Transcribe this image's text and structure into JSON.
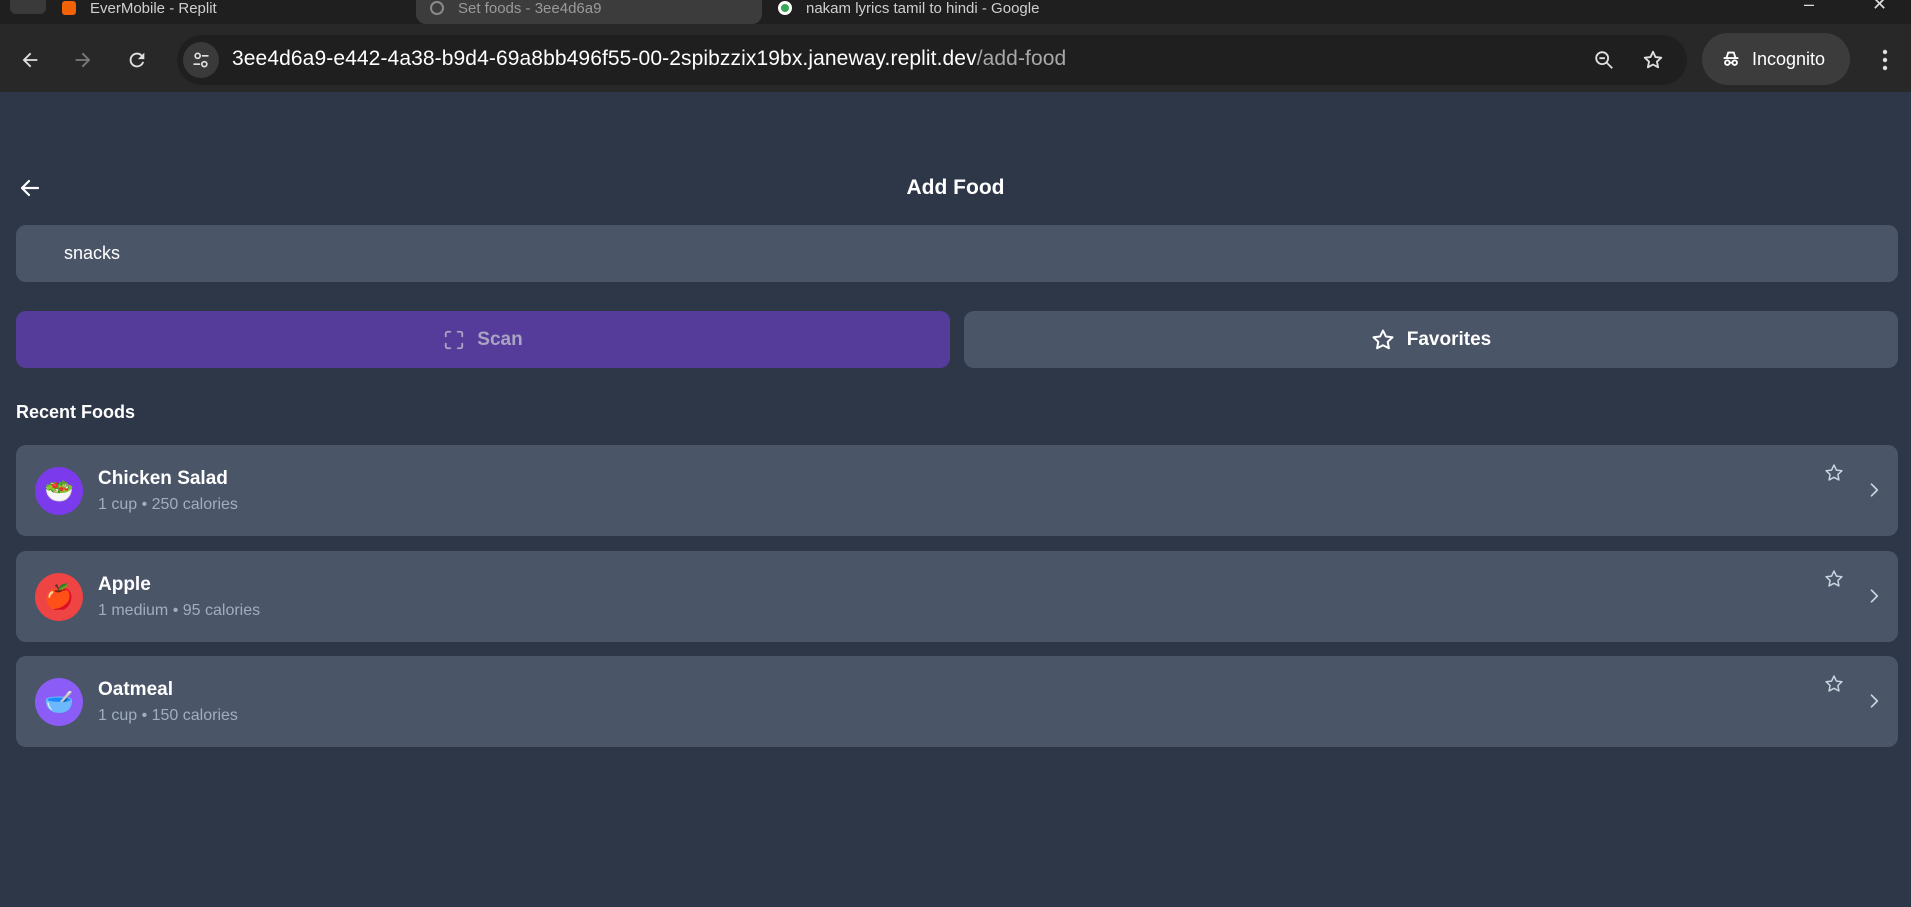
{
  "browser": {
    "tabs": [
      {
        "title": ""
      },
      {
        "title": "EverMobile - Replit"
      },
      {
        "title": "Set foods - 3ee4d6a9"
      },
      {
        "title": "nakam lyrics tamil to hindi - Google"
      }
    ],
    "url_host": "3ee4d6a9-e442-4a38-b9d4-69a8bb496f55-00-2spibzzix19bx.janeway.replit.dev",
    "url_path": "/add-food",
    "incognito_label": "Incognito"
  },
  "page": {
    "title": "Add Food",
    "search_value": "snacks",
    "scan_label": "Scan",
    "favorites_label": "Favorites",
    "recent_title": "Recent Foods"
  },
  "foods": [
    {
      "name": "Chicken Salad",
      "meta": "1 cup • 250 calories",
      "emoji": "🥗",
      "color": "#7c3aed"
    },
    {
      "name": "Apple",
      "meta": "1 medium • 95 calories",
      "emoji": "🍎",
      "color": "#ef4444"
    },
    {
      "name": "Oatmeal",
      "meta": "1 cup • 150 calories",
      "emoji": "🥣",
      "color": "#8b5cf6"
    }
  ],
  "icons": {
    "back": "arrow-left-icon",
    "scan": "scan-frame-icon",
    "favorites": "star-icon",
    "chevron": "chevron-right-icon"
  },
  "colors": {
    "background": "#2d3748",
    "card": "#4a5568",
    "scan_button": "#553c9a"
  }
}
